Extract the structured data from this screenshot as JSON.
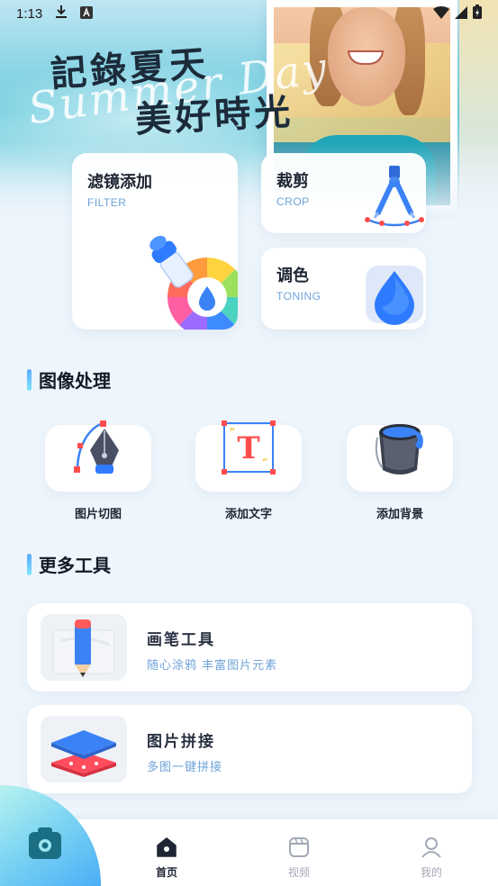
{
  "status_bar": {
    "time": "1:13",
    "left_icons": [
      "download-icon",
      "keyboard-a-icon"
    ],
    "right_icons": [
      "wifi-icon",
      "signal-icon",
      "battery-charging-icon"
    ]
  },
  "hero": {
    "title_line1": "記錄夏天",
    "title_line2": "美好時光",
    "script_text": "Summer Day"
  },
  "feature_cards": {
    "filter": {
      "title": "滤镜添加",
      "subtitle": "FILTER",
      "icon": "color-wheel-icon"
    },
    "crop": {
      "title": "裁剪",
      "subtitle": "CROP",
      "icon": "compass-crop-icon"
    },
    "tone": {
      "title": "调色",
      "subtitle": "TONING",
      "icon": "water-drop-icon"
    }
  },
  "image_processing": {
    "section_title": "图像处理",
    "tools": [
      {
        "label": "图片切图",
        "icon": "pen-tool-icon"
      },
      {
        "label": "添加文字",
        "icon": "text-box-icon"
      },
      {
        "label": "添加背景",
        "icon": "paint-bucket-icon"
      }
    ]
  },
  "more_tools": {
    "section_title": "更多工具",
    "items": [
      {
        "title": "画笔工具",
        "subtitle": "随心涂鸦 丰富图片元素",
        "icon": "pencil-icon"
      },
      {
        "title": "图片拼接",
        "subtitle": "多图一键拼接",
        "icon": "layers-icon"
      }
    ]
  },
  "bottom_nav": {
    "items": [
      {
        "label": "首页",
        "icon": "home-icon",
        "active": true
      },
      {
        "label": "视频",
        "icon": "video-icon",
        "active": false
      },
      {
        "label": "我的",
        "icon": "user-icon",
        "active": false
      }
    ],
    "fab_icon": "camera-icon"
  },
  "colors": {
    "accent_blue": "#4a90ff",
    "subtitle_blue": "#6fa3d8",
    "page_bg": "#eef5fc"
  }
}
